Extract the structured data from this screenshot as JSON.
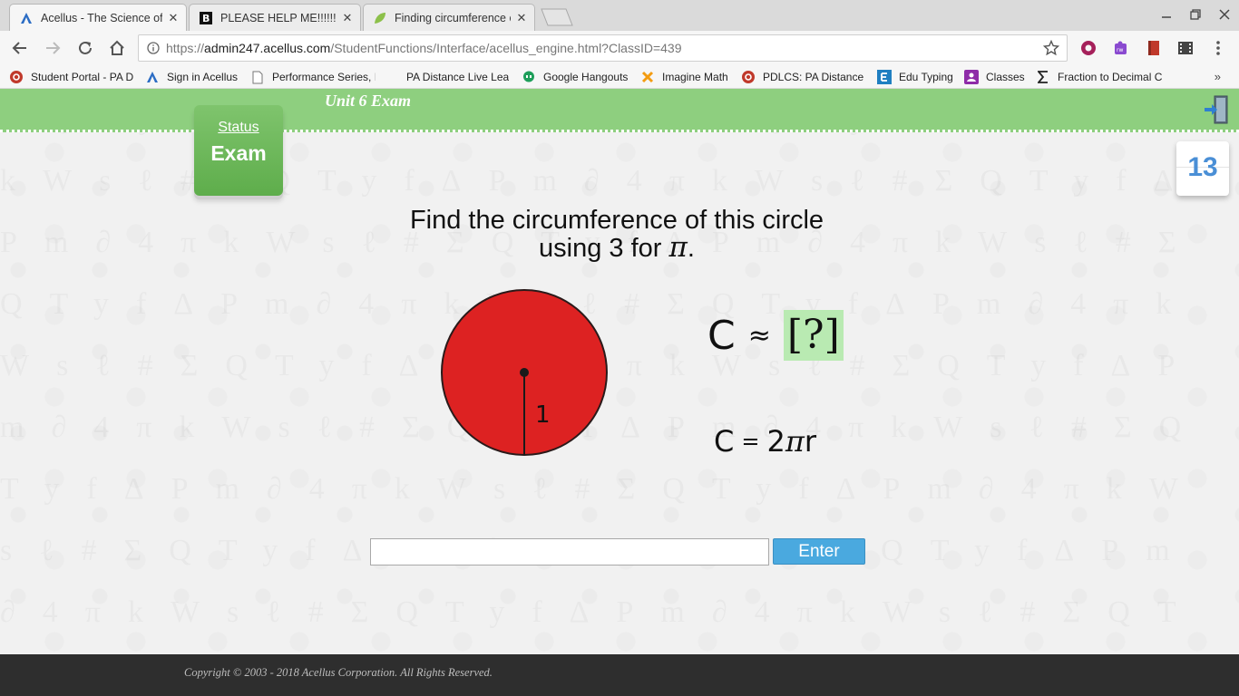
{
  "browser": {
    "tabs": [
      {
        "title": "Acellus - The Science of",
        "icon": "acellus-icon",
        "active": true
      },
      {
        "title": "PLEASE HELP ME!!!!!!! - B",
        "icon": "brainly-icon",
        "active": false
      },
      {
        "title": "Finding circumference o",
        "icon": "leaf-icon",
        "active": false
      }
    ],
    "address": {
      "scheme": "https://",
      "host": "admin247.acellus.com",
      "path": "/StudentFunctions/Interface/acellus_engine.html?ClassID=439"
    },
    "bookmarks": [
      {
        "label": "Student Portal - PA D",
        "icon": "pdlcs-icon"
      },
      {
        "label": "Sign in Acellus",
        "icon": "acellus-icon"
      },
      {
        "label": "Performance Series, I",
        "icon": "page-icon"
      },
      {
        "label": "PA Distance Live Lea",
        "icon": "blank-icon"
      },
      {
        "label": "Google Hangouts",
        "icon": "hangouts-icon"
      },
      {
        "label": "Imagine Math",
        "icon": "imagine-math-icon"
      },
      {
        "label": "PDLCS: PA Distance I",
        "icon": "pdlcs-icon"
      },
      {
        "label": "Edu Typing",
        "icon": "edu-typing-icon"
      },
      {
        "label": "Classes",
        "icon": "classes-icon"
      },
      {
        "label": "Fraction to Decimal C",
        "icon": "sigma-icon"
      }
    ],
    "more_bookmarks": "»"
  },
  "page": {
    "unit_title": "Unit 6 Exam",
    "status_label": "Status",
    "status_value": "Exam",
    "question_number": "13",
    "prompt_line1": "Find the circumference of this circle",
    "prompt_line2": "using 3 for",
    "prompt_pi": "π",
    "prompt_period": ".",
    "radius_label": "1",
    "formula_top": {
      "lhs": "C",
      "approx": "≈",
      "answer": "[?]"
    },
    "formula_bottom": {
      "lhs": "C",
      "eq": "=",
      "rhs_num": "2",
      "rhs_pi": "π",
      "rhs_var": "r"
    },
    "answer_value": "",
    "enter_label": "Enter"
  },
  "footer": {
    "copyright": "Copyright © 2003 - 2018 Acellus Corporation.  All Rights Reserved."
  },
  "colors": {
    "header_green": "#8ecf7f",
    "circle_red": "#dd2222",
    "answer_box_green": "#b9eab2",
    "enter_blue": "#4aa9df",
    "counter_blue": "#4a8fd6"
  }
}
